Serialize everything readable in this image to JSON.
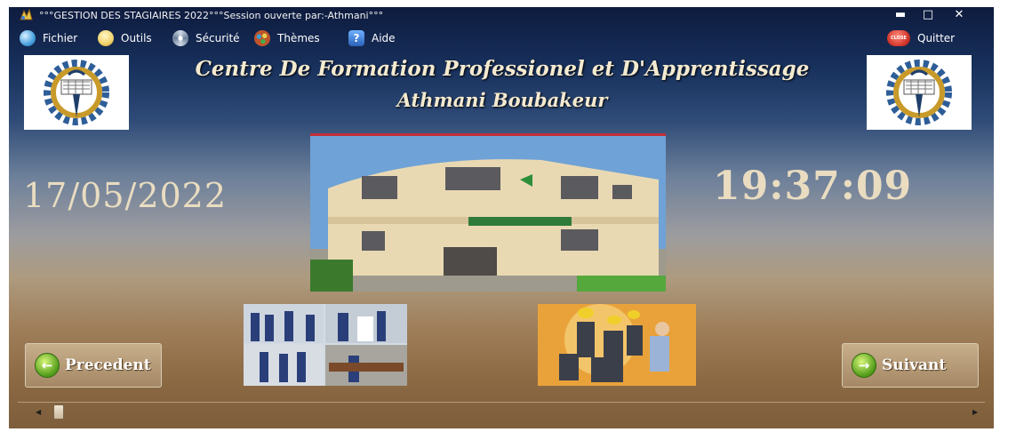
{
  "window": {
    "title": "°°°GESTION DES STAGIAIRES 2022°°°Session ouverte par:-Athmani°°°",
    "controls": {
      "minimize": "▬",
      "maximize": "□",
      "close": "✕"
    }
  },
  "menu": {
    "items": [
      {
        "label": "Fichier",
        "icon": "disk-icon",
        "color": "#4aa3df"
      },
      {
        "label": "Outils",
        "icon": "lightbulb-icon",
        "color": "#f1d36b"
      },
      {
        "label": "Sécurité",
        "icon": "atom-icon",
        "color": "#cfd8e6"
      },
      {
        "label": "Thèmes",
        "icon": "palette-icon",
        "color": "#c0542b"
      },
      {
        "label": "Aide",
        "icon": "help-icon",
        "color": "#3b7fd4"
      }
    ],
    "quit": {
      "label": "Quitter",
      "icon": "close-sign-icon",
      "icon_text": "CLOSE",
      "color": "#d63a2f"
    }
  },
  "header": {
    "line1": "Centre De Formation Professionel et  D'Apprentissage",
    "line2": "Athmani Boubakeur"
  },
  "date": "17/05/2022",
  "time": "19:37:09",
  "nav": {
    "previous": "Precedent",
    "next": "Suivant"
  },
  "colors": {
    "heading": "#f4ead0",
    "clock": "#e9dcc0",
    "nav_button": "#b89a74"
  }
}
